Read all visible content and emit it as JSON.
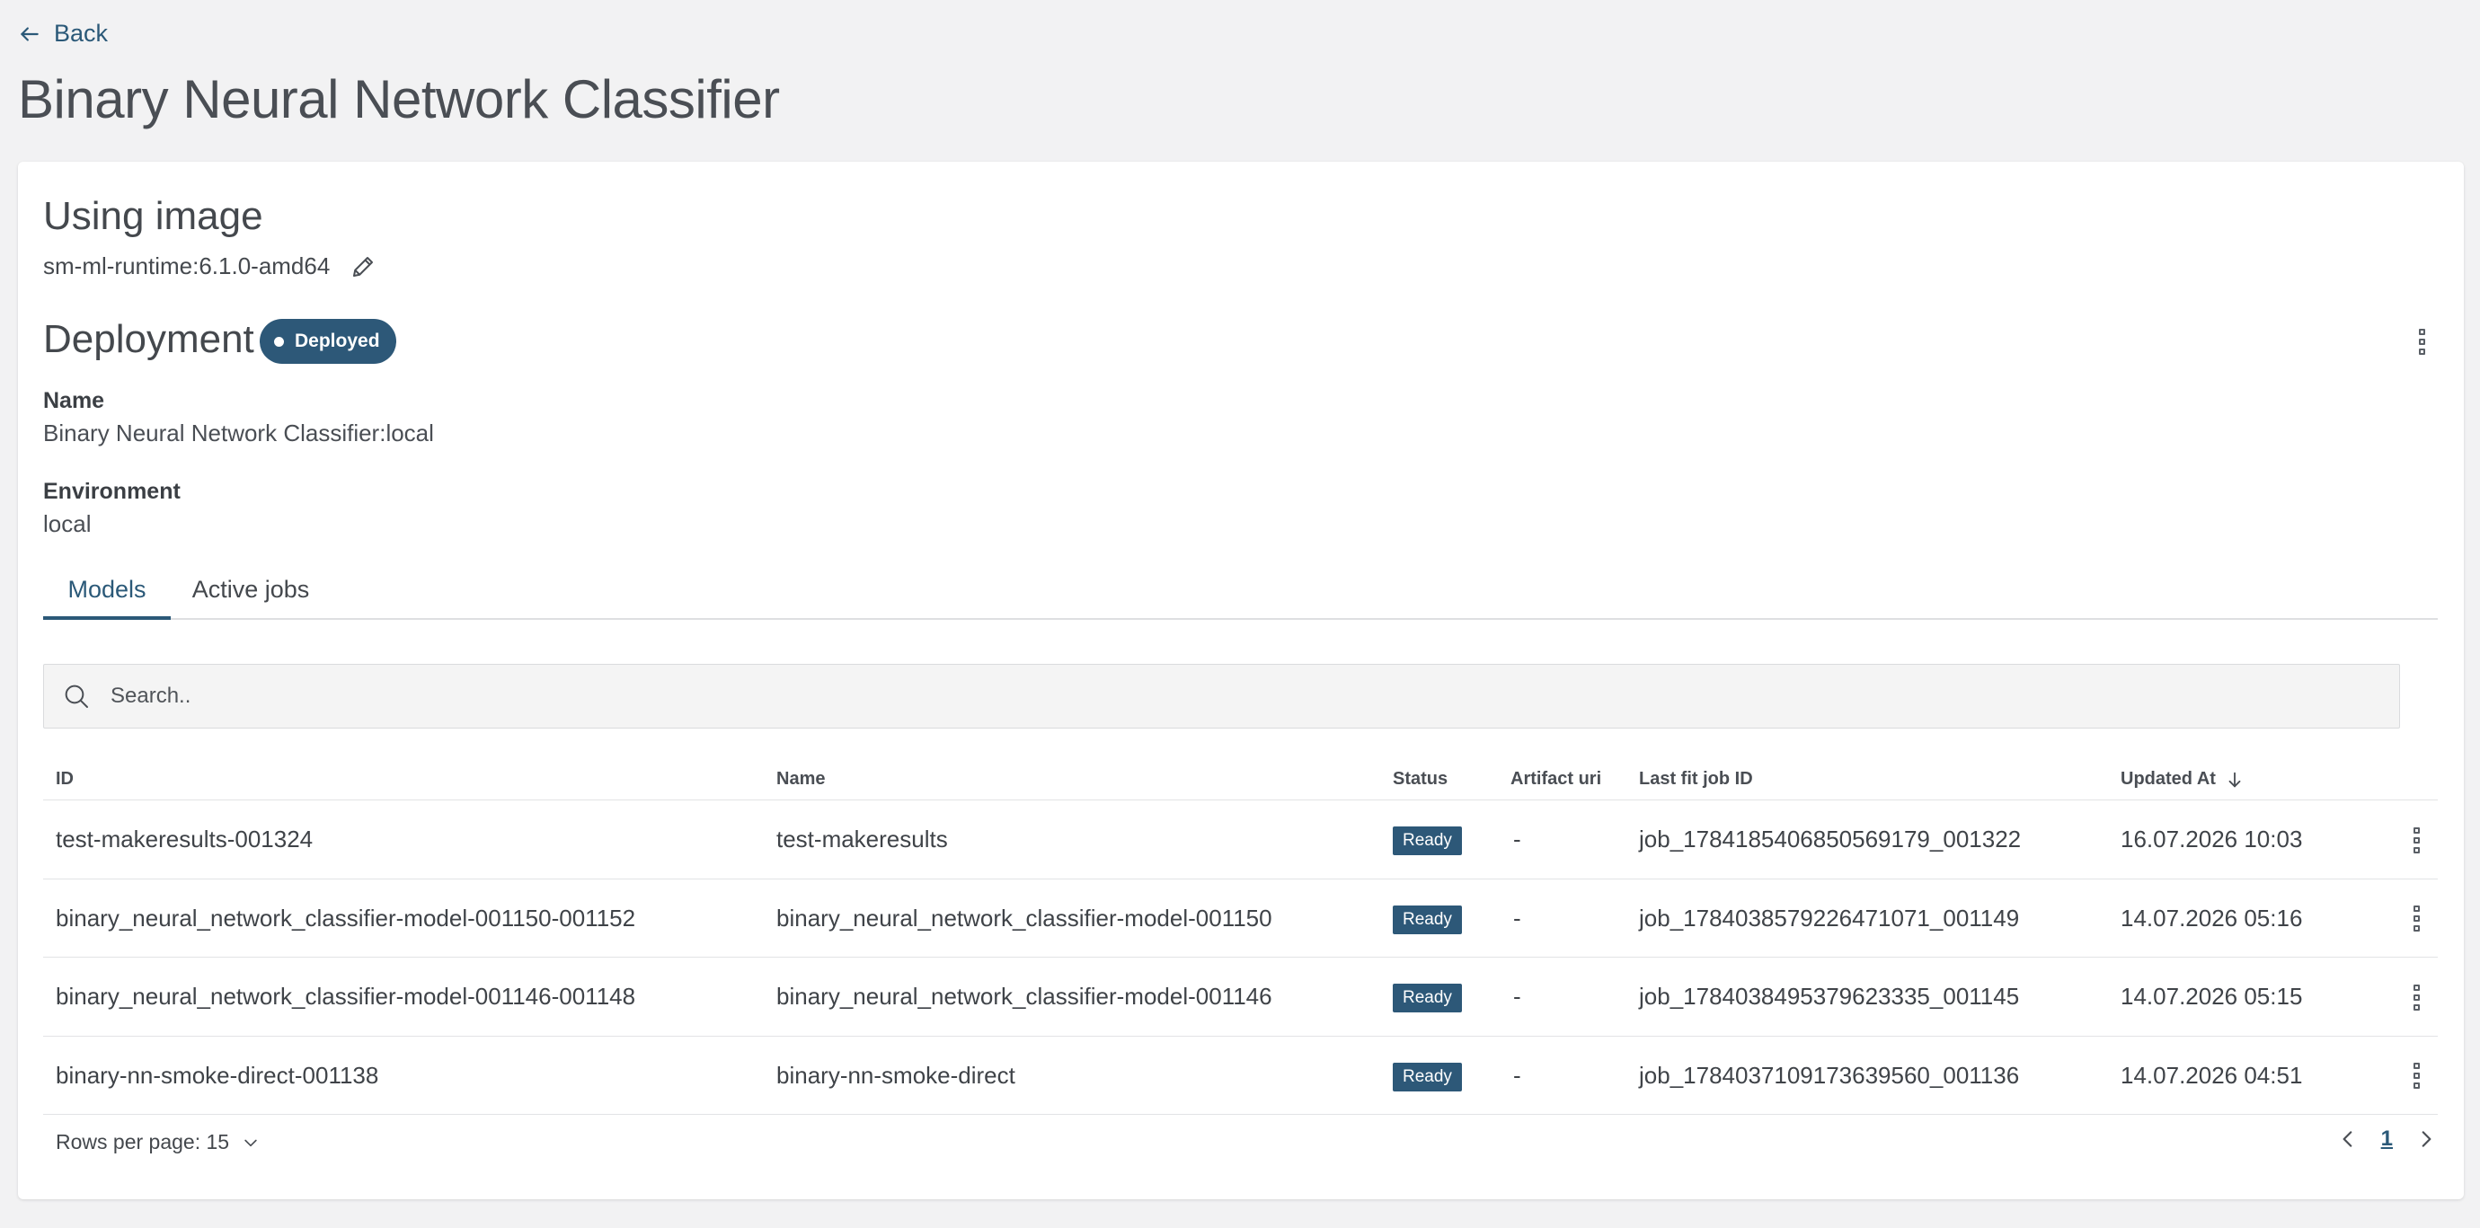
{
  "nav": {
    "back_label": "Back"
  },
  "page": {
    "title": "Binary Neural Network Classifier"
  },
  "image_section": {
    "heading": "Using image",
    "image_name": "sm-ml-runtime:6.1.0-amd64"
  },
  "deployment": {
    "heading": "Deployment",
    "status": "Deployed",
    "name_label": "Name",
    "name_value": "Binary Neural Network Classifier:local",
    "environment_label": "Environment",
    "environment_value": "local"
  },
  "tabs": [
    {
      "label": "Models",
      "active": true
    },
    {
      "label": "Active jobs",
      "active": false
    }
  ],
  "search": {
    "placeholder": "Search..",
    "value": ""
  },
  "table": {
    "columns": {
      "id": "ID",
      "name": "Name",
      "status": "Status",
      "artifact_uri": "Artifact uri",
      "last_fit_job_id": "Last fit job ID",
      "updated_at": "Updated At"
    },
    "sort": {
      "column": "updated_at",
      "direction": "desc"
    },
    "rows": [
      {
        "id": "test-makeresults-001324",
        "name": "test-makeresults",
        "status": "Ready",
        "artifact_uri": "-",
        "last_fit_job_id": "job_1784185406850569179_001322",
        "updated_at": "16.07.2026 10:03"
      },
      {
        "id": "binary_neural_network_classifier-model-001150-001152",
        "name": "binary_neural_network_classifier-model-001150",
        "status": "Ready",
        "artifact_uri": "-",
        "last_fit_job_id": "job_1784038579226471071_001149",
        "updated_at": "14.07.2026 05:16"
      },
      {
        "id": "binary_neural_network_classifier-model-001146-001148",
        "name": "binary_neural_network_classifier-model-001146",
        "status": "Ready",
        "artifact_uri": "-",
        "last_fit_job_id": "job_1784038495379623335_001145",
        "updated_at": "14.07.2026 05:15"
      },
      {
        "id": "binary-nn-smoke-direct-001138",
        "name": "binary-nn-smoke-direct",
        "status": "Ready",
        "artifact_uri": "-",
        "last_fit_job_id": "job_1784037109173639560_001136",
        "updated_at": "14.07.2026 04:51"
      }
    ]
  },
  "pagination": {
    "rows_per_page_label": "Rows per page: 15",
    "current_page": "1"
  },
  "colors": {
    "accent": "#2b5978",
    "badge_bg": "#2d5878",
    "page_bg": "#f2f2f3",
    "card_bg": "#ffffff"
  },
  "icons": {
    "back": "arrow-left-icon",
    "edit": "pencil-icon",
    "menu": "kebab-menu-icon",
    "search": "search-icon",
    "sort": "arrow-down-icon",
    "dropdown": "chevron-down-icon",
    "prev": "chevron-left-icon",
    "next": "chevron-right-icon"
  }
}
